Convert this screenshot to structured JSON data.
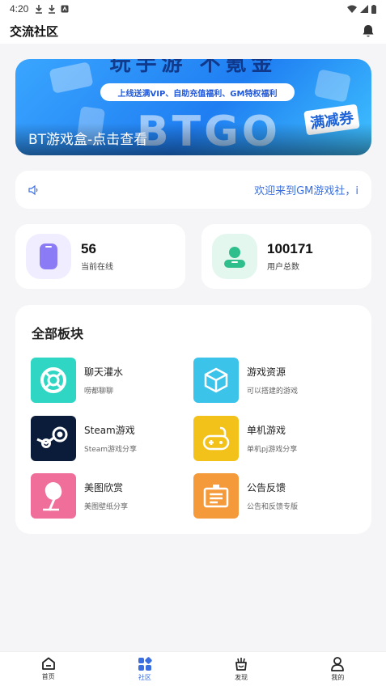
{
  "status_bar": {
    "time": "4:20",
    "left_icons": [
      "download-icon",
      "download-icon",
      "app-icon"
    ],
    "right_icons": [
      "wifi-icon",
      "signal-icon",
      "battery-icon"
    ]
  },
  "app_bar": {
    "title": "交流社区",
    "right_icon": "bell-icon"
  },
  "banner": {
    "top_text": "玩手游 不氪金",
    "pill_text": "上线送满VIP、自助充值福利、GM特权福利",
    "ghost_text": "BTGO",
    "coupon_text": "满减券",
    "caption": "BT游戏盒-点击查看"
  },
  "notice": {
    "icon": "speaker-icon",
    "text": "欢迎来到GM游戏社，i"
  },
  "stats": [
    {
      "icon": "phone-icon",
      "number": "56",
      "label": "当前在线",
      "color": "#8b7cf6",
      "bg": "#efedff"
    },
    {
      "icon": "user-icon",
      "number": "100171",
      "label": "用户总数",
      "color": "#2fbf8c",
      "bg": "#e4f7ef"
    }
  ],
  "sections": {
    "heading": "全部板块",
    "items": [
      {
        "name": "聊天灌水",
        "desc": "唠都聊聊",
        "icon": "lifebuoy-icon",
        "color": "#2fd6c4"
      },
      {
        "name": "游戏资源",
        "desc": "可以搭建的游戏",
        "icon": "cube-icon",
        "color": "#3cc3ea"
      },
      {
        "name": "Steam游戏",
        "desc": "Steam游戏分享",
        "icon": "steam-icon",
        "color": "#0b1c3a"
      },
      {
        "name": "单机游戏",
        "desc": "单机pj游戏分享",
        "icon": "gamepad-icon",
        "color": "#f2c21a"
      },
      {
        "name": "美图欣赏",
        "desc": "美图壁纸分享",
        "icon": "icecream-icon",
        "color": "#f06f9a"
      },
      {
        "name": "公告反馈",
        "desc": "公告和反馈专版",
        "icon": "notice-board-icon",
        "color": "#f59a3b"
      }
    ]
  },
  "tab_bar": {
    "active_color": "#3b6fe0",
    "tabs": [
      {
        "label": "首页",
        "icon": "home-icon"
      },
      {
        "label": "社区",
        "icon": "community-icon"
      },
      {
        "label": "发现",
        "icon": "discover-icon"
      },
      {
        "label": "我的",
        "icon": "profile-icon"
      }
    ]
  }
}
